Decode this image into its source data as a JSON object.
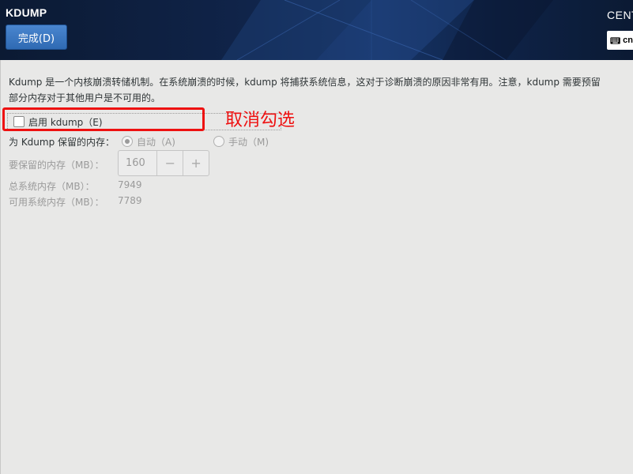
{
  "header": {
    "title": "KDUMP",
    "done_label": "完成(D)",
    "brand": "CENT",
    "keyboard_label": "cn"
  },
  "description": {
    "line1": "Kdump 是一个内核崩溃转储机制。在系统崩溃的时候，kdump 将捕获系统信息，这对于诊断崩溃的原因非常有用。注意，kdump 需要预留",
    "line2": "部分内存对于其他用户是不可用的。"
  },
  "enable": {
    "label": "启用 kdump（E)",
    "checked": false
  },
  "annotation": "取消勾选",
  "reserve": {
    "label": "为 Kdump 保留的内存：",
    "auto_label": "自动（A)",
    "manual_label": "手动（M)"
  },
  "memory": {
    "reserve_label": "要保留的内存（MB）：",
    "reserve_value": "160",
    "minus": "−",
    "plus": "+",
    "total_label": "总系统内存（MB）：",
    "total_value": "7949",
    "usable_label": "可用系统内存（MB）：",
    "usable_value": "7789"
  },
  "colors": {
    "accent": "#3a78c2",
    "header_bg": "#10244a",
    "annotation": "#ee1111"
  }
}
